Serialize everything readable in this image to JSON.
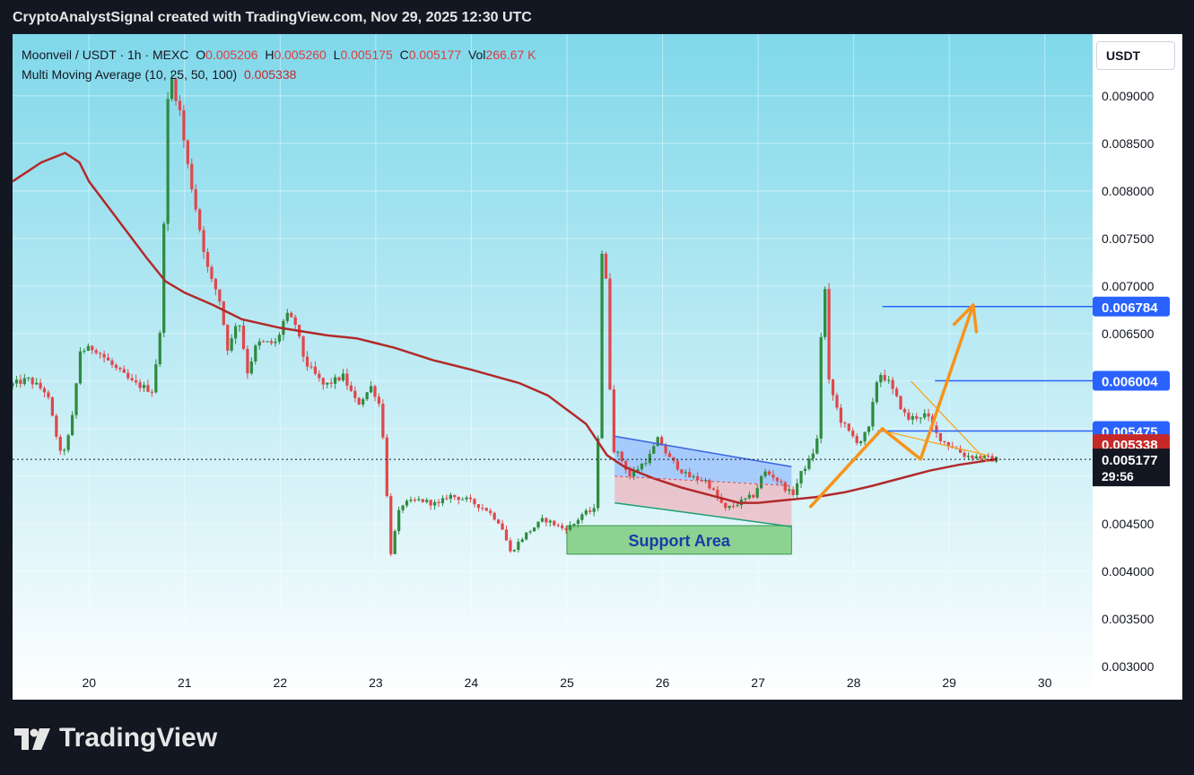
{
  "header": {
    "title": "CryptoAnalystSignal created with TradingView.com, Nov 29, 2025 12:30 UTC"
  },
  "legend": {
    "symbol": "Moonveil / USDT · 1h · MEXC",
    "o_label": "O",
    "o_value": "0.005206",
    "h_label": "H",
    "h_value": "0.005260",
    "l_label": "L",
    "l_value": "0.005175",
    "c_label": "C",
    "c_value": "0.005177",
    "vol_label": "Vol",
    "vol_value": "266.67 K",
    "indicator": "Multi Moving Average (10, 25, 50, 100)",
    "indicator_value": "0.005338"
  },
  "currency_button": "USDT",
  "footer": {
    "brand": "TradingView"
  },
  "chart_data": {
    "type": "candlestick",
    "x_axis": {
      "ticks": [
        "20",
        "21",
        "22",
        "23",
        "24",
        "25",
        "26",
        "27",
        "28",
        "29",
        "30"
      ],
      "range_days": [
        19.2,
        30.5
      ]
    },
    "y_axis": {
      "ticks": [
        "0.009000",
        "0.008500",
        "0.008000",
        "0.007500",
        "0.007000",
        "0.006500",
        "0.006000",
        "0.005500",
        "0.005000",
        "0.004500",
        "0.004000",
        "0.003500",
        "0.003000"
      ],
      "range": [
        0.00265,
        0.00965
      ],
      "scale": "linear",
      "side": "right"
    },
    "grid": true,
    "background": {
      "top": "#7fd8ea",
      "bottom": "#ffffff"
    },
    "colors": {
      "up": "#2e8b3e",
      "down": "#e0474c",
      "ma": "#b22a2a",
      "arrow": "#f7931a",
      "channel_line": "#3a63e0",
      "support_line": "#1e9e73",
      "level_line": "#2962ff"
    },
    "ohlc_path": [
      [
        19.2,
        0.00595
      ],
      [
        19.4,
        0.00602
      ],
      [
        19.6,
        0.00588
      ],
      [
        19.75,
        0.0052
      ],
      [
        19.85,
        0.00548
      ],
      [
        19.95,
        0.00632
      ],
      [
        20.1,
        0.00635
      ],
      [
        20.3,
        0.00615
      ],
      [
        20.5,
        0.00598
      ],
      [
        20.7,
        0.0059
      ],
      [
        20.8,
        0.0066
      ],
      [
        20.85,
        0.0088
      ],
      [
        20.9,
        0.0092
      ],
      [
        21.0,
        0.0088
      ],
      [
        21.05,
        0.0084
      ],
      [
        21.2,
        0.0076
      ],
      [
        21.3,
        0.0071
      ],
      [
        21.4,
        0.0069
      ],
      [
        21.5,
        0.0063
      ],
      [
        21.6,
        0.0067
      ],
      [
        21.7,
        0.0061
      ],
      [
        21.8,
        0.0064
      ],
      [
        22.0,
        0.0064
      ],
      [
        22.1,
        0.0067
      ],
      [
        22.2,
        0.0066
      ],
      [
        22.3,
        0.0062
      ],
      [
        22.5,
        0.00595
      ],
      [
        22.7,
        0.00605
      ],
      [
        22.85,
        0.00575
      ],
      [
        23.0,
        0.00595
      ],
      [
        23.1,
        0.0057
      ],
      [
        23.15,
        0.0049
      ],
      [
        23.2,
        0.0042
      ],
      [
        23.3,
        0.0047
      ],
      [
        23.5,
        0.00475
      ],
      [
        23.7,
        0.0047
      ],
      [
        23.8,
        0.0048
      ],
      [
        24.0,
        0.00475
      ],
      [
        24.2,
        0.00465
      ],
      [
        24.35,
        0.0045
      ],
      [
        24.45,
        0.0042
      ],
      [
        24.6,
        0.00438
      ],
      [
        24.8,
        0.00455
      ],
      [
        25.0,
        0.00445
      ],
      [
        25.1,
        0.00448
      ],
      [
        25.2,
        0.0046
      ],
      [
        25.35,
        0.00465
      ],
      [
        25.42,
        0.0079
      ],
      [
        25.48,
        0.0062
      ],
      [
        25.52,
        0.0053
      ],
      [
        25.6,
        0.0052
      ],
      [
        25.7,
        0.005
      ],
      [
        25.8,
        0.0051
      ],
      [
        25.9,
        0.0052
      ],
      [
        26.0,
        0.0054
      ],
      [
        26.1,
        0.0052
      ],
      [
        26.3,
        0.005
      ],
      [
        26.5,
        0.00495
      ],
      [
        26.7,
        0.00465
      ],
      [
        26.8,
        0.0047
      ],
      [
        27.0,
        0.0048
      ],
      [
        27.1,
        0.00505
      ],
      [
        27.2,
        0.005
      ],
      [
        27.3,
        0.0049
      ],
      [
        27.4,
        0.0048
      ],
      [
        27.5,
        0.00505
      ],
      [
        27.6,
        0.0052
      ],
      [
        27.68,
        0.00545
      ],
      [
        27.72,
        0.0075
      ],
      [
        27.78,
        0.006
      ],
      [
        27.9,
        0.0056
      ],
      [
        28.0,
        0.00545
      ],
      [
        28.1,
        0.00535
      ],
      [
        28.2,
        0.0055
      ],
      [
        28.3,
        0.0061
      ],
      [
        28.4,
        0.006
      ],
      [
        28.5,
        0.0058
      ],
      [
        28.6,
        0.0056
      ],
      [
        28.8,
        0.00565
      ],
      [
        28.9,
        0.00545
      ],
      [
        29.0,
        0.00535
      ],
      [
        29.1,
        0.0053
      ],
      [
        29.2,
        0.00522
      ],
      [
        29.35,
        0.0052
      ],
      [
        29.5,
        0.005177
      ]
    ],
    "moving_average_path": [
      [
        19.2,
        0.0081
      ],
      [
        19.5,
        0.0083
      ],
      [
        19.75,
        0.0084
      ],
      [
        19.9,
        0.0083
      ],
      [
        20.0,
        0.0081
      ],
      [
        20.3,
        0.0077
      ],
      [
        20.6,
        0.0073
      ],
      [
        20.8,
        0.00705
      ],
      [
        21.0,
        0.00693
      ],
      [
        21.3,
        0.0068
      ],
      [
        21.6,
        0.00665
      ],
      [
        22.0,
        0.00656
      ],
      [
        22.5,
        0.00648
      ],
      [
        22.8,
        0.00645
      ],
      [
        23.0,
        0.0064
      ],
      [
        23.2,
        0.00635
      ],
      [
        23.6,
        0.00622
      ],
      [
        24.0,
        0.00612
      ],
      [
        24.5,
        0.00598
      ],
      [
        24.8,
        0.00585
      ],
      [
        25.0,
        0.0057
      ],
      [
        25.2,
        0.00555
      ],
      [
        25.3,
        0.0054
      ],
      [
        25.42,
        0.00522
      ],
      [
        25.6,
        0.0051
      ],
      [
        25.9,
        0.00498
      ],
      [
        26.2,
        0.00488
      ],
      [
        26.5,
        0.0048
      ],
      [
        26.8,
        0.00472
      ],
      [
        27.0,
        0.00472
      ],
      [
        27.3,
        0.00475
      ],
      [
        27.6,
        0.00478
      ],
      [
        27.9,
        0.00483
      ],
      [
        28.2,
        0.0049
      ],
      [
        28.5,
        0.00498
      ],
      [
        28.8,
        0.00506
      ],
      [
        29.1,
        0.00512
      ],
      [
        29.5,
        0.00518
      ]
    ],
    "price_labels": [
      {
        "value": 0.006784,
        "text": "0.006784",
        "color": "#2962ff",
        "line_from_day": 28.3
      },
      {
        "value": 0.006004,
        "text": "0.006004",
        "color": "#2962ff",
        "line_from_day": 28.85
      },
      {
        "value": 0.005475,
        "text": "0.005475",
        "color": "#2962ff",
        "line_from_day": 28.25
      },
      {
        "value": 0.005338,
        "text": "0.005338",
        "color": "#c62828"
      },
      {
        "value": 0.005177,
        "text": "0.005177",
        "color": "#131722",
        "timer": "29:56"
      }
    ],
    "support_area": {
      "label": "Support Area",
      "y_low": 0.00418,
      "y_high": 0.00448,
      "x_start": 25.0,
      "x_end": 27.35
    },
    "channel": {
      "top": [
        [
          25.5,
          0.00542
        ],
        [
          27.35,
          0.0051
        ]
      ],
      "bottom": [
        [
          25.5,
          0.00472
        ],
        [
          27.35,
          0.00447
        ]
      ],
      "mid": [
        [
          25.5,
          0.005
        ],
        [
          27.35,
          0.0049
        ]
      ]
    },
    "triangle": {
      "upper": [
        [
          28.6,
          0.006
        ],
        [
          29.4,
          0.00515
        ]
      ],
      "lower": [
        [
          28.3,
          0.00548
        ],
        [
          29.4,
          0.00522
        ]
      ]
    },
    "arrows": [
      {
        "points": [
          [
            27.55,
            0.00468
          ],
          [
            28.3,
            0.0055
          ],
          [
            28.7,
            0.00518
          ],
          [
            29.25,
            0.0068
          ]
        ],
        "head": true
      }
    ]
  }
}
